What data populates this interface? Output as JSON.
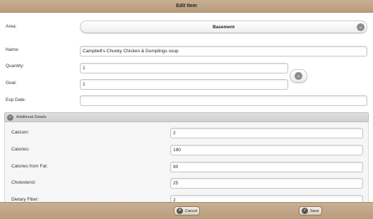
{
  "dialog": {
    "title": "Edit Item"
  },
  "form": {
    "area": {
      "label": "Area:",
      "value": "Basement"
    },
    "name": {
      "label": "Name:",
      "value": "Campbell's Chunky Chicken & Dumplings soup"
    },
    "quantity": {
      "label": "Quantity:",
      "value": "1"
    },
    "goal": {
      "label": "Goal:",
      "value": "1"
    },
    "exp_date": {
      "label": "Exp Date:",
      "value": ""
    }
  },
  "additional": {
    "header": "Additional Details",
    "fields": [
      {
        "label": "Calcium:",
        "value": "2"
      },
      {
        "label": "Calories:",
        "value": "190"
      },
      {
        "label": "Calories from Fat:",
        "value": "90"
      },
      {
        "label": "Cholesterol:",
        "value": "25"
      },
      {
        "label": "Dietary Fiber:",
        "value": "2"
      }
    ]
  },
  "footer": {
    "cancel_label": "Cancel",
    "save_label": "Save"
  },
  "icons": {
    "area_dropdown": "chevron-down-icon",
    "quantity_goal_toggle": "chevron-down-icon",
    "collapse": "minus-circle-icon",
    "cancel": "x-circle-icon",
    "save": "check-circle-icon"
  },
  "colors": {
    "bar": "#c2a888",
    "section_header": "#d6d6d6"
  }
}
